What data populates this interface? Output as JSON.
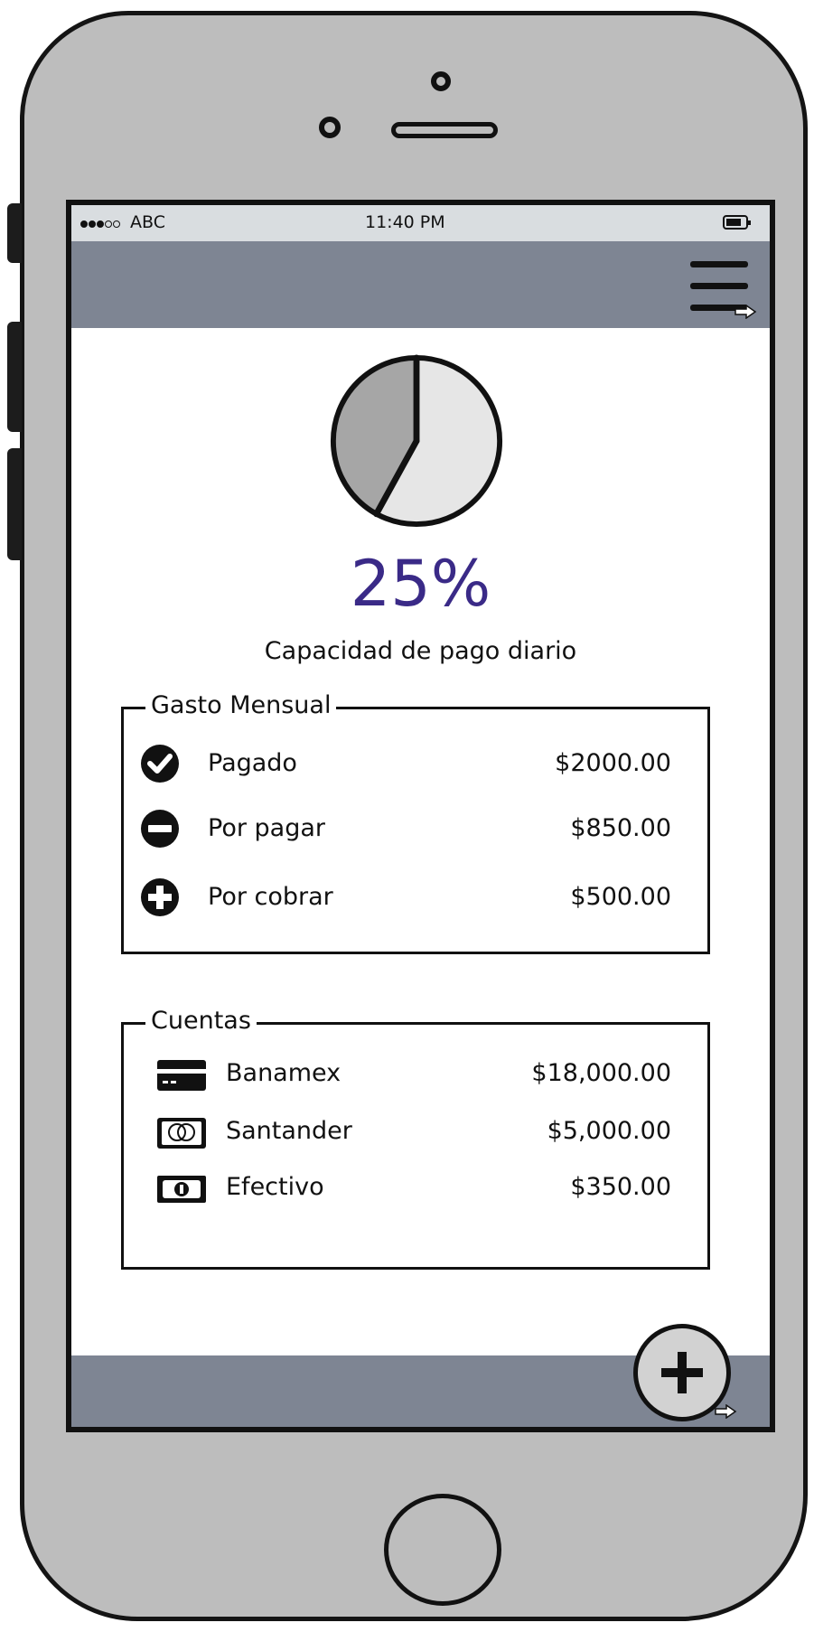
{
  "status_bar": {
    "signal_dots": 5,
    "signal_filled": 3,
    "carrier": "ABC",
    "time": "11:40 PM",
    "battery_icon": "battery-icon"
  },
  "top_bar": {
    "menu_icon": "hamburger-menu-icon"
  },
  "summary": {
    "percent": "25%",
    "caption": "Capacidad de pago diario",
    "pie_chart": {
      "type": "pie",
      "slices": [
        {
          "value": 58,
          "color": "#e6e6e6"
        },
        {
          "value": 42,
          "color": "#a6a6a6"
        }
      ]
    }
  },
  "gasto_mensual": {
    "title": "Gasto Mensual",
    "items": [
      {
        "icon": "check-circle-icon",
        "label": "Pagado",
        "value": "$2000.00"
      },
      {
        "icon": "minus-circle-icon",
        "label": "Por pagar",
        "value": "$850.00"
      },
      {
        "icon": "plus-circle-icon",
        "label": "Por cobrar",
        "value": "$500.00"
      }
    ]
  },
  "cuentas": {
    "title": "Cuentas",
    "items": [
      {
        "icon": "credit-card-icon",
        "label": "Banamex",
        "value": "$18,000.00"
      },
      {
        "icon": "mastercard-icon",
        "label": "Santander",
        "value": "$5,000.00"
      },
      {
        "icon": "cash-icon",
        "label": "Efectivo",
        "value": "$350.00"
      }
    ]
  },
  "fab": {
    "icon": "plus-icon"
  },
  "colors": {
    "bars": "#7e8593",
    "status_bar": "#d9dde0",
    "accent_percent": "#3a2a87",
    "phone_body": "#bdbdbd"
  }
}
